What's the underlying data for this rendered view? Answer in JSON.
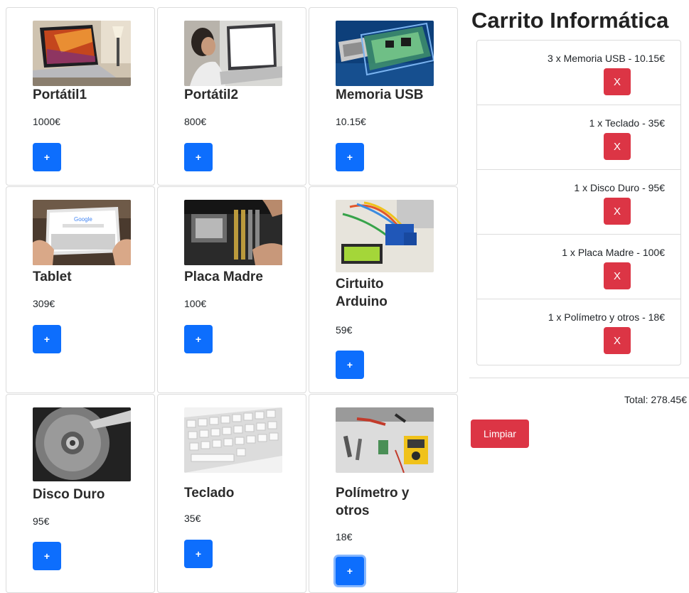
{
  "products": [
    {
      "name": "Portátil1",
      "price": "1000€",
      "add_label": "+",
      "image": "laptop-photo"
    },
    {
      "name": "Portátil2",
      "price": "800€",
      "add_label": "+",
      "image": "laptop-user-photo"
    },
    {
      "name": "Memoria USB",
      "price": "10.15€",
      "add_label": "+",
      "image": "usb-memory-photo"
    },
    {
      "name": "Tablet",
      "price": "309€",
      "add_label": "+",
      "image": "tablet-photo"
    },
    {
      "name": "Placa Madre",
      "price": "100€",
      "add_label": "+",
      "image": "motherboard-photo"
    },
    {
      "name": "Cirtuito Arduino",
      "price": "59€",
      "add_label": "+",
      "image": "arduino-circuit-photo"
    },
    {
      "name": "Disco Duro",
      "price": "95€",
      "add_label": "+",
      "image": "hard-disk-photo"
    },
    {
      "name": "Teclado",
      "price": "35€",
      "add_label": "+",
      "image": "keyboard-photo"
    },
    {
      "name": "Polímetro y otros",
      "price": "18€",
      "add_label": "+",
      "image": "multimeter-tools-photo"
    }
  ],
  "cart": {
    "title": "Carrito Informática",
    "items": [
      {
        "text": "3 x Memoria USB - 10.15€",
        "remove_label": "X"
      },
      {
        "text": "1 x Teclado - 35€",
        "remove_label": "X"
      },
      {
        "text": "1 x Disco Duro - 95€",
        "remove_label": "X"
      },
      {
        "text": "1 x Placa Madre - 100€",
        "remove_label": "X"
      },
      {
        "text": "1 x Polímetro y otros - 18€",
        "remove_label": "X"
      }
    ],
    "total": "Total: 278.45€",
    "clear_label": "Limpiar"
  },
  "colors": {
    "primary": "#0d6efd",
    "danger": "#dc3545",
    "border": "#dcdcdc"
  }
}
